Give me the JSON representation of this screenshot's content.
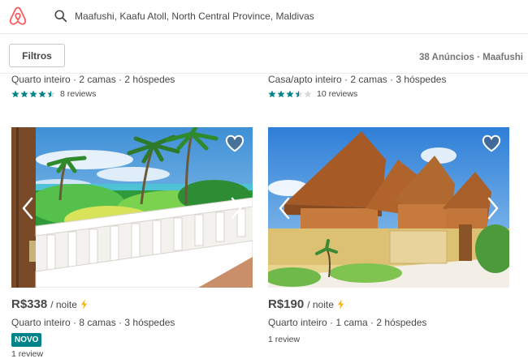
{
  "header": {
    "logo_icon": "airbnb-logo",
    "search_icon": "search-icon",
    "search_text": "Maafushi, Kaafu Atoll, North Central Province, Maldivas"
  },
  "toolbar": {
    "filters_label": "Filtros",
    "listing_count": "38 Anúncios · Maafushi"
  },
  "previous_cards": [
    {
      "details": "Quarto inteiro · 2 camas · 2 hóspedes",
      "rating": 4.5,
      "reviews": "8 reviews"
    },
    {
      "details": "Casa/apto inteiro · 2 camas · 3 hóspedes",
      "rating": 3.5,
      "reviews": "10 reviews"
    }
  ],
  "cards": [
    {
      "price": "R$338",
      "per": "/ noite",
      "details": "Quarto inteiro · 8 camas · 3 hóspedes",
      "badge": "NOVO",
      "reviews": "1 review",
      "instant_icon": "lightning-icon"
    },
    {
      "price": "R$190",
      "per": "/ noite",
      "details": "Quarto inteiro · 1 cama · 2 hóspedes",
      "reviews": "1 review",
      "instant_icon": "lightning-icon"
    }
  ],
  "colors": {
    "brand": "#FF5A5F",
    "teal": "#008489",
    "star": "#008489",
    "bolt": "#FFB400"
  }
}
